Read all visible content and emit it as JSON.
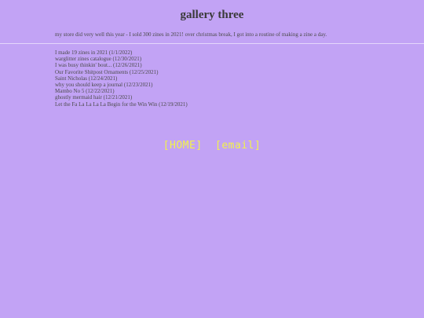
{
  "page": {
    "title": "gallery three",
    "intro": "my store did very well this year - I sold 300 zines in 2021! over christmas break, I got into a routine of making a zine a day."
  },
  "posts": [
    {
      "label": "I made 19 zines in 2021 (1/1/2022)"
    },
    {
      "label": "warglitter zines catalogue (12/30/2021)"
    },
    {
      "label": "I was busy thinkin' bout... (12/26/2021)"
    },
    {
      "label": "Our Favorite Shitpost Ornaments (12/25/2021)"
    },
    {
      "label": "Saint Nicholas (12/24/2021)"
    },
    {
      "label": "why you should keep a journal (12/23/2021)"
    },
    {
      "label": "Mambo No 5 (12/22/2021)"
    },
    {
      "label": "ghostly mermaid hair (12/21/2021)"
    },
    {
      "label": "Let the Fa La La La La Begin for the Win Win (12/19/2021)"
    }
  ],
  "nav": {
    "home_label": "[HOME]",
    "email_label": "[email]"
  },
  "colors": {
    "background": "#c2a3f5",
    "nav_text": "#f2f24c",
    "body_text": "#4a4a4a"
  }
}
